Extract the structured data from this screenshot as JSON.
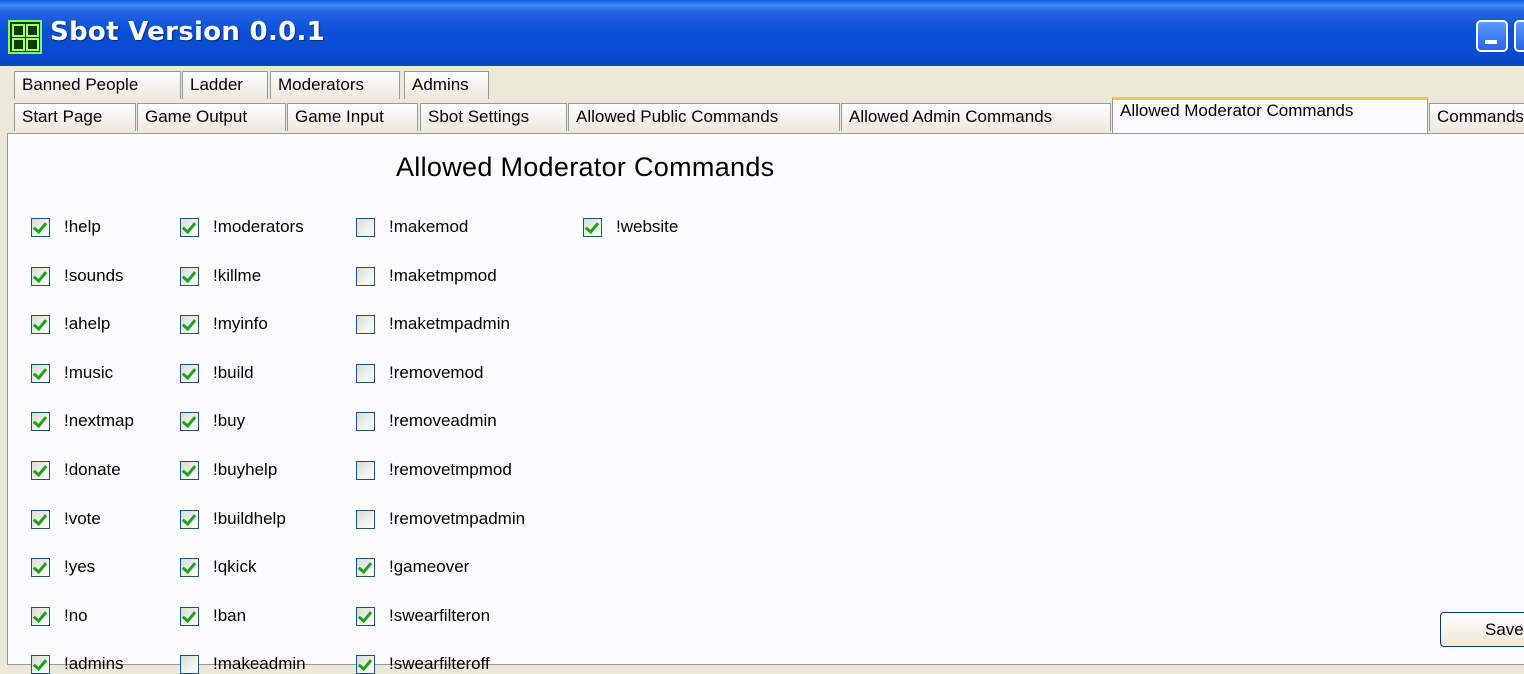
{
  "window": {
    "title": "Sbot Version 0.0.1",
    "icon": "sbot-app-icon"
  },
  "tabs_row1": [
    "Banned People",
    "Ladder",
    "Moderators",
    "Admins"
  ],
  "tabs_row2": [
    "Start Page",
    "Game Output",
    "Game Input",
    "Sbot Settings",
    "Allowed Public Commands",
    "Allowed Admin Commands",
    "Allowed Moderator Commands",
    "Commands"
  ],
  "active_tab": "Allowed Moderator Commands",
  "panel": {
    "heading": "Allowed Moderator Commands"
  },
  "columns": [
    [
      {
        "label": "!help",
        "checked": true
      },
      {
        "label": "!sounds",
        "checked": true
      },
      {
        "label": "!ahelp",
        "checked": true
      },
      {
        "label": "!music",
        "checked": true
      },
      {
        "label": "!nextmap",
        "checked": true
      },
      {
        "label": "!donate",
        "checked": true
      },
      {
        "label": "!vote",
        "checked": true
      },
      {
        "label": "!yes",
        "checked": true
      },
      {
        "label": "!no",
        "checked": true
      },
      {
        "label": "!admins",
        "checked": true
      }
    ],
    [
      {
        "label": "!moderators",
        "checked": true
      },
      {
        "label": "!killme",
        "checked": true
      },
      {
        "label": "!myinfo",
        "checked": true
      },
      {
        "label": "!build",
        "checked": true
      },
      {
        "label": "!buy",
        "checked": true
      },
      {
        "label": "!buyhelp",
        "checked": true
      },
      {
        "label": "!buildhelp",
        "checked": true
      },
      {
        "label": "!qkick",
        "checked": true
      },
      {
        "label": "!ban",
        "checked": true
      },
      {
        "label": "!makeadmin",
        "checked": false
      }
    ],
    [
      {
        "label": "!makemod",
        "checked": false
      },
      {
        "label": "!maketmpmod",
        "checked": false
      },
      {
        "label": "!maketmpadmin",
        "checked": false
      },
      {
        "label": "!removemod",
        "checked": false
      },
      {
        "label": "!removeadmin",
        "checked": false
      },
      {
        "label": "!removetmpmod",
        "checked": false
      },
      {
        "label": "!removetmpadmin",
        "checked": false
      },
      {
        "label": "!gameover",
        "checked": true
      },
      {
        "label": "!swearfilteron",
        "checked": true
      },
      {
        "label": "!swearfilteroff",
        "checked": true
      }
    ],
    [
      {
        "label": "!website",
        "checked": true
      }
    ]
  ],
  "save_button": {
    "label": "Save"
  },
  "colors": {
    "titlebar": "#0a52d8",
    "active_tab_accent": "#ffc83c",
    "check": "#21a121"
  }
}
